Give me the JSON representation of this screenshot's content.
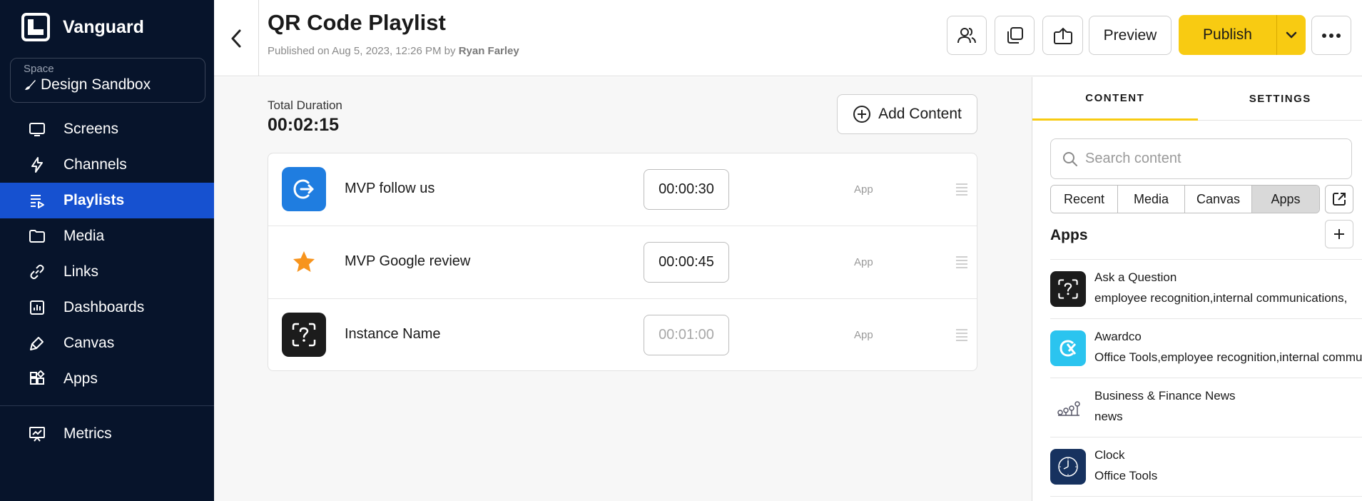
{
  "sidebar": {
    "brand": "Vanguard",
    "space_label": "Space",
    "space_name": "Design Sandbox",
    "items": [
      {
        "label": "Screens",
        "icon": "monitor-icon"
      },
      {
        "label": "Channels",
        "icon": "lightning-icon"
      },
      {
        "label": "Playlists",
        "icon": "playlist-icon",
        "active": true
      },
      {
        "label": "Media",
        "icon": "folder-icon"
      },
      {
        "label": "Links",
        "icon": "link-icon"
      },
      {
        "label": "Dashboards",
        "icon": "dashboard-icon"
      },
      {
        "label": "Canvas",
        "icon": "brush-icon"
      },
      {
        "label": "Apps",
        "icon": "apps-icon"
      }
    ],
    "metrics": {
      "label": "Metrics",
      "icon": "metrics-icon"
    }
  },
  "header": {
    "title": "QR Code Playlist",
    "published_prefix": "Published on Aug 5, 2023, 12:26 PM by",
    "published_by": "Ryan Farley",
    "preview_label": "Preview",
    "publish_label": "Publish"
  },
  "main": {
    "total_duration_label": "Total Duration",
    "total_duration": "00:02:15",
    "add_content_label": "Add Content",
    "items": [
      {
        "name": "MVP follow us",
        "duration": "00:00:30",
        "type": "App",
        "icon": "follow-us-icon"
      },
      {
        "name": "MVP Google review",
        "duration": "00:00:45",
        "type": "App",
        "icon": "star-icon"
      },
      {
        "name": "Instance Name",
        "duration": "00:01:00",
        "type": "App",
        "icon": "question-scan-icon"
      }
    ]
  },
  "panel": {
    "tabs": [
      "CONTENT",
      "SETTINGS"
    ],
    "search_placeholder": "Search content",
    "filters": [
      "Recent",
      "Media",
      "Canvas",
      "Apps"
    ],
    "apps_title": "Apps",
    "apps": [
      {
        "name": "Ask a Question",
        "tags": "employee recognition,internal communications,"
      },
      {
        "name": "Awardco",
        "tags": "Office Tools,employee recognition,internal commu"
      },
      {
        "name": "Business & Finance News",
        "tags": "news"
      },
      {
        "name": "Clock",
        "tags": "Office Tools"
      }
    ]
  },
  "colors": {
    "sidebar_bg": "#07142b",
    "active_nav": "#1651d0",
    "publish": "#f8cb12"
  }
}
